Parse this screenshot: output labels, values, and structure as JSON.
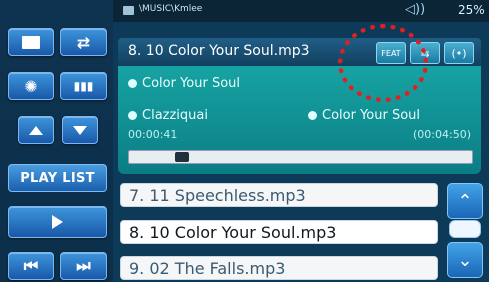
{
  "status": {
    "path": "\\MUSIC\\Kmlee",
    "battery": "25%"
  },
  "now_playing": {
    "title": "8. 10 Color Your Soul.mp3",
    "song": "Color Your Soul",
    "artist": "Clazziquai",
    "album": "Color Your Soul",
    "elapsed": "00:00:41",
    "total": "(00:04:50)",
    "progress_fraction": 0.14,
    "icons": [
      "feat-icon",
      "mode-icon",
      "stereo-icon"
    ],
    "feat_label": "FEAT"
  },
  "left_controls": {
    "playlist_label": "PLAY LIST"
  },
  "playlist": [
    {
      "label": "7. 11 Speechless.mp3",
      "active": false
    },
    {
      "label": "8. 10 Color Your Soul.mp3",
      "active": true
    },
    {
      "label": "9. 02 The Falls.mp3",
      "active": false
    }
  ],
  "colors": {
    "accent": "#2d7ed1",
    "info_panel": "#0f9393",
    "highlight_circle": "#e02020"
  }
}
